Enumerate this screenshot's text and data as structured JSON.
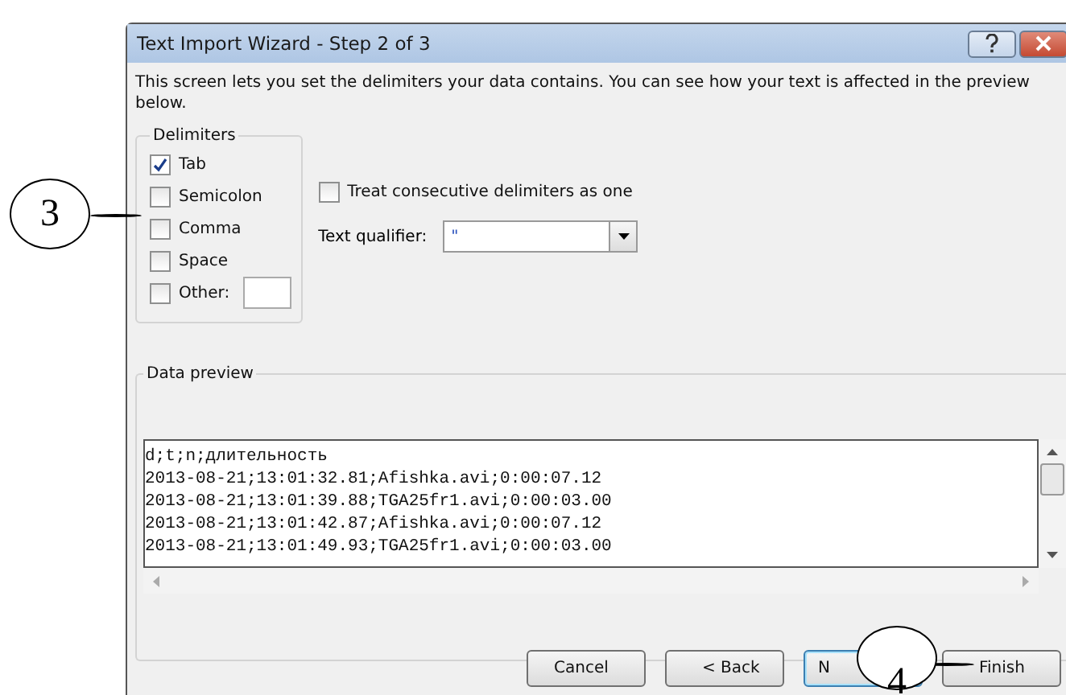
{
  "window": {
    "title": "Text Import Wizard - Step 2 of 3"
  },
  "intro": "This screen lets you set the delimiters your data contains.  You can see how your text is affected in the preview below.",
  "delimiters": {
    "title": "Delimiters",
    "items": [
      {
        "label": "Tab",
        "checked": true
      },
      {
        "label": "Semicolon",
        "checked": false
      },
      {
        "label": "Comma",
        "checked": false
      },
      {
        "label": "Space",
        "checked": false
      },
      {
        "label": "Other:",
        "checked": false,
        "kind": "other"
      }
    ]
  },
  "consecutive": {
    "label": "Treat consecutive delimiters as one",
    "checked": false
  },
  "qualifier": {
    "label": "Text qualifier:",
    "value": "\""
  },
  "preview": {
    "title": "Data preview",
    "lines": [
      "d;t;n;длительность",
      "2013-08-21;13:01:32.81;Afishka.avi;0:00:07.12",
      "2013-08-21;13:01:39.88;TGA25fr1.avi;0:00:03.00",
      "2013-08-21;13:01:42.87;Afishka.avi;0:00:07.12",
      "2013-08-21;13:01:49.93;TGA25fr1.avi;0:00:03.00"
    ]
  },
  "buttons": [
    {
      "label": "Cancel",
      "selected": false
    },
    {
      "label": "< Back",
      "selected": false
    },
    {
      "label": "N",
      "selected": true
    },
    {
      "label": "Finish",
      "selected": false
    }
  ],
  "callouts": [
    {
      "label": "3",
      "kind": "left"
    },
    {
      "label": "4",
      "kind": "right"
    }
  ]
}
